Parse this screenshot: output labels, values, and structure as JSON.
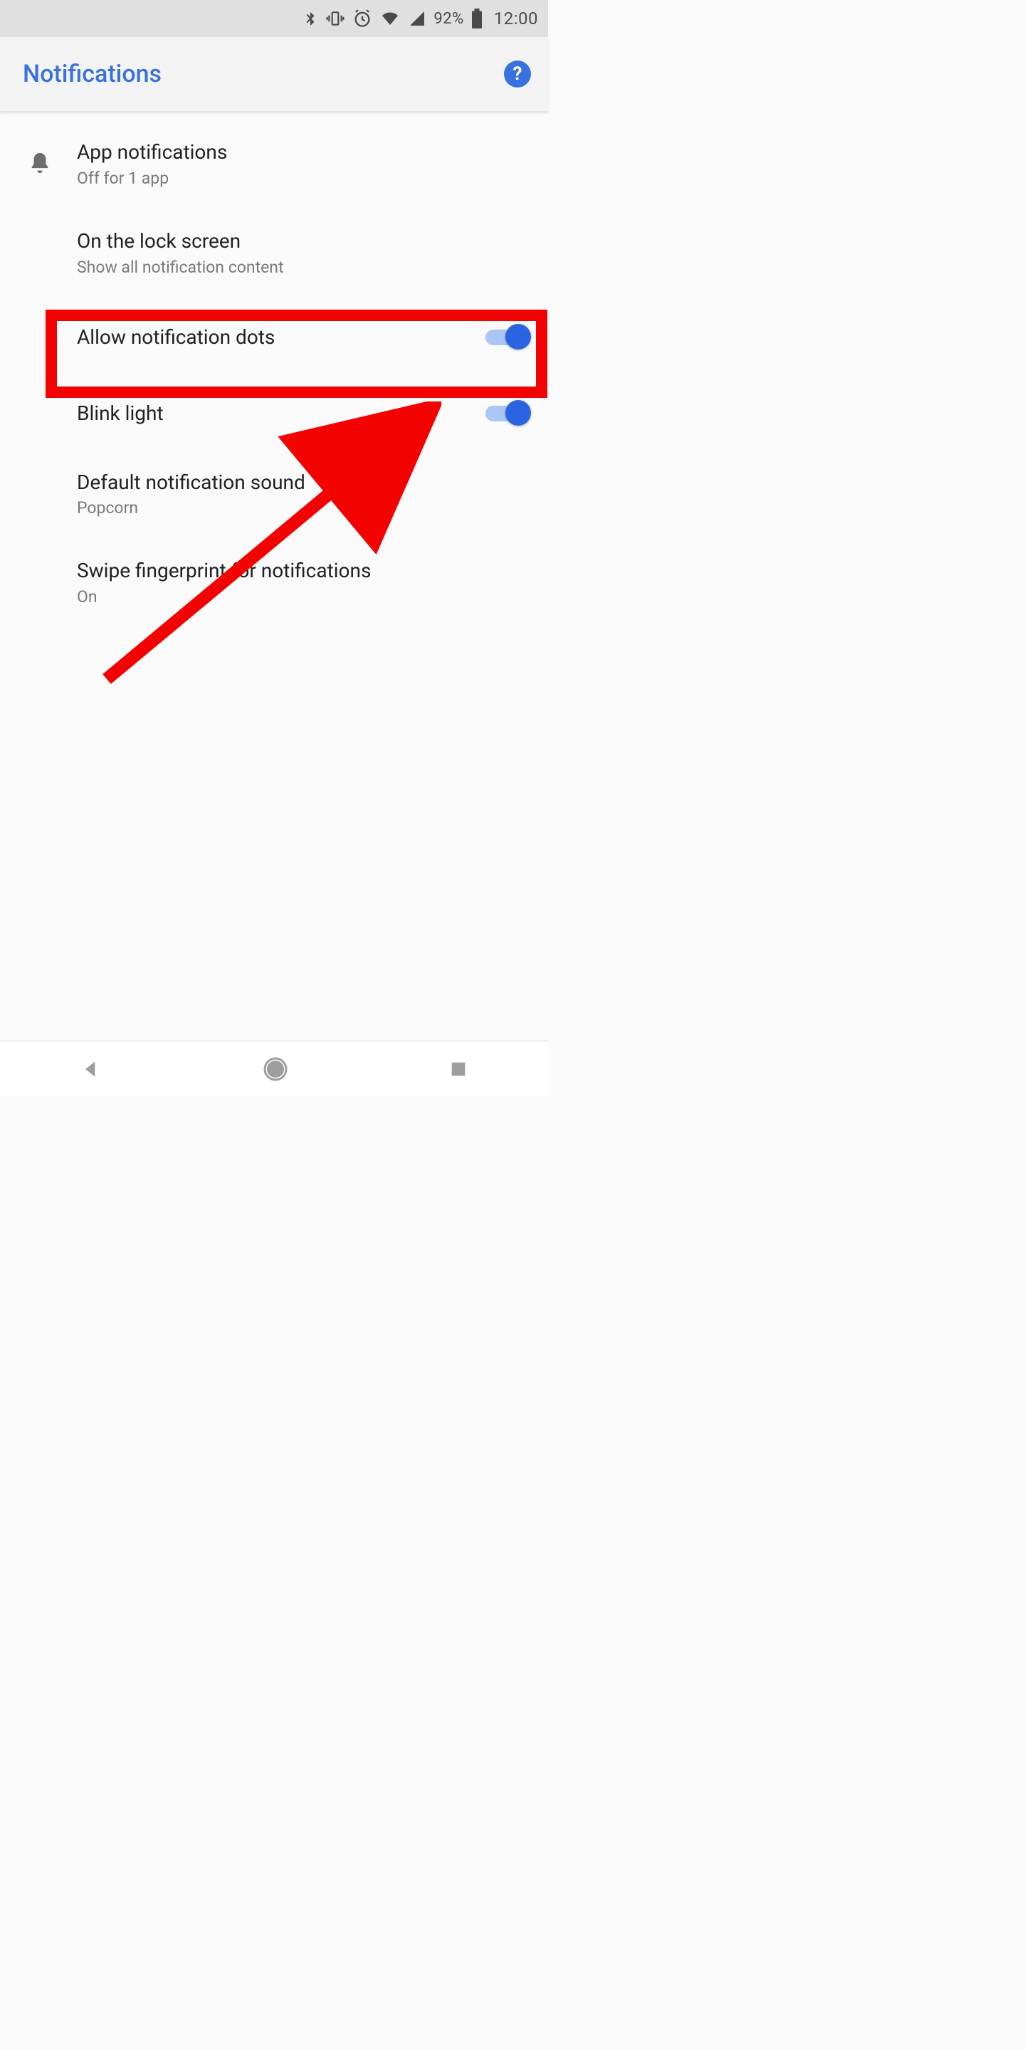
{
  "status": {
    "battery_percent": "92%",
    "time": "12:00"
  },
  "header": {
    "title": "Notifications"
  },
  "settings": {
    "app_notifications": {
      "title": "App notifications",
      "subtitle": "Off for 1 app"
    },
    "lock_screen": {
      "title": "On the lock screen",
      "subtitle": "Show all notification content"
    },
    "dots": {
      "title": "Allow notification dots"
    },
    "blink": {
      "title": "Blink light"
    },
    "sound": {
      "title": "Default notification sound",
      "subtitle": "Popcorn"
    },
    "swipe_fp": {
      "title": "Swipe fingerprint for notifications",
      "subtitle": "On"
    }
  },
  "annotation": {
    "highlight_target": "Allow notification dots"
  }
}
